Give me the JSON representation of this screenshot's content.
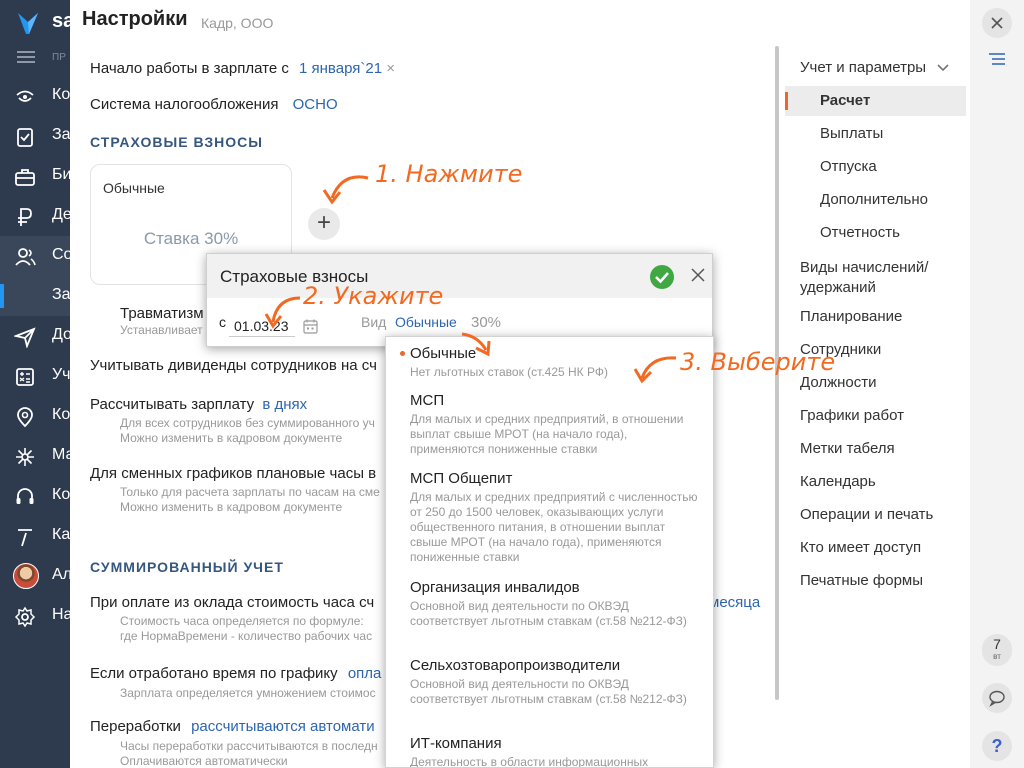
{
  "nav": {
    "brand": "sa",
    "menu_label": "ПР",
    "items": [
      {
        "label": "Ко",
        "icon": "home-icon"
      },
      {
        "label": "За",
        "icon": "tasks-icon"
      },
      {
        "label": "Би",
        "icon": "briefcase-icon"
      },
      {
        "label": "Де",
        "icon": "money-icon"
      },
      {
        "label": "Со",
        "icon": "staff-icon"
      },
      {
        "label": "За",
        "icon": "salary-sub-icon"
      },
      {
        "label": "До",
        "icon": "send-icon"
      },
      {
        "label": "Уч",
        "icon": "accounting-icon"
      },
      {
        "label": "Ко",
        "icon": "location-icon"
      },
      {
        "label": "Ма",
        "icon": "marketing-icon"
      },
      {
        "label": "Ко",
        "icon": "headset-icon"
      },
      {
        "label": "Ка",
        "icon": "calendar-icon"
      },
      {
        "label": "Ал",
        "icon": "avatar"
      },
      {
        "label": "На",
        "icon": "gear-icon"
      }
    ]
  },
  "header": {
    "title": "Настройки",
    "subtitle": "Кадр, ООО"
  },
  "main": {
    "start_label": "Начало работы в зарплате с",
    "start_value": "1 января`21",
    "tax_label": "Система налогообложения",
    "tax_value": "ОСНО",
    "section_insurance": "СТРАХОВЫЕ ВЗНОСЫ",
    "card_title": "Обычные",
    "card_rate": "Ставка 30%",
    "add_symbol": "+",
    "trauma_label": "Травматизм",
    "trauma_hint": "Устанавливает",
    "dividends_label": "Учитывать дивиденды сотрудников на сч",
    "calc_label": "Рассчитывать зарплату",
    "calc_value": "в днях",
    "calc_hint1": "Для всех сотрудников без суммированного уч",
    "calc_hint2": "Можно изменить в кадровом документе",
    "shift_label": "Для сменных графиков плановые часы в",
    "shift_hint1": "Только для расчета зарплаты по часам на сме",
    "shift_hint2": "Можно изменить в кадровом документе",
    "section_summary": "СУММИРОВАННЫЙ УЧЕТ",
    "oklad_label": "При оплате из оклада стоимость часа сч",
    "oklad_value": "месяца",
    "oklad_hint1": "Стоимость часа определяется по формуле:",
    "oklad_hint2": "где НормаВремени - количество рабочих час",
    "worked_label": "Если отработано время по графику",
    "worked_value": "опла",
    "worked_hint": "Зарплата определяется умножением стоимос",
    "overtime_label": "Переработки",
    "overtime_value": "рассчитываются автомати",
    "overtime_hint1": "Часы переработки рассчитываются в последн",
    "overtime_hint2": "Оплачиваются автоматически"
  },
  "popup": {
    "title": "Страховые взносы",
    "date_prefix": "с",
    "date_value": "01.03.23",
    "kind_label": "Вид",
    "kind_value": "Обычные",
    "rate_value": "30%"
  },
  "dropdown": {
    "options": [
      {
        "title": "Обычные",
        "desc": "Нет льготных ставок (ст.425 НК РФ)",
        "selected": true
      },
      {
        "title": "МСП",
        "desc": "Для малых и средних предприятий, в отношении выплат свыше МРОТ (на начало года), применяются пониженные ставки"
      },
      {
        "title": "МСП Общепит",
        "desc": "Для малых и средних предприятий с численностью от 250 до 1500 человек, оказывающих услуги общественного питания, в отношении выплат свыше МРОТ (на начало года), применяются пониженные ставки"
      },
      {
        "title": "Организация инвалидов",
        "desc": "Основной вид деятельности по ОКВЭД соответствует льготным ставкам (ст.58 №212-ФЗ)"
      },
      {
        "title": "Сельхозтоваропроизводители",
        "desc": "Основной вид деятельности по ОКВЭД соответствует льготным ставкам (ст.58 №212-ФЗ)"
      },
      {
        "title": "ИТ-компания",
        "desc": "Деятельность в области информационных"
      }
    ]
  },
  "rightpanel": {
    "group": "Учет и параметры",
    "subitems": [
      "Расчет",
      "Выплаты",
      "Отпуска",
      "Дополнительно",
      "Отчетность"
    ],
    "items": [
      "Виды начислений/\nудержаний",
      "Планирование",
      "Сотрудники",
      "Должности",
      "Графики работ",
      "Метки табеля",
      "Календарь",
      "Операции и печать",
      "Кто имеет доступ",
      "Печатные формы"
    ]
  },
  "rightbar": {
    "date_num": "7",
    "date_day": "вт",
    "help": "?"
  },
  "annotations": {
    "step1": "1. Нажмите",
    "step2": "2. Укажите",
    "step3": "3. Выберите",
    "color": "#f26a21"
  }
}
